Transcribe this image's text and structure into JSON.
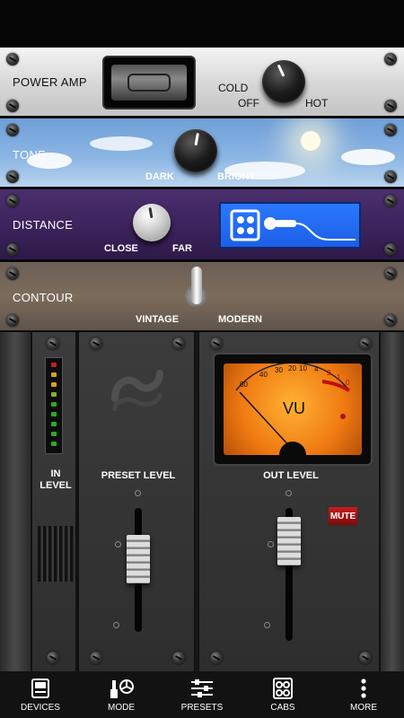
{
  "panels": {
    "power_amp": {
      "label": "POWER AMP",
      "left_label": "COLD",
      "off_label": "OFF",
      "right_label": "HOT"
    },
    "tone": {
      "label": "TONE",
      "left_label": "DARK",
      "right_label": "BRIGHT"
    },
    "distance": {
      "label": "DISTANCE",
      "left_label": "CLOSE",
      "right_label": "FAR"
    },
    "contour": {
      "label": "CONTOUR",
      "left_label": "VINTAGE",
      "right_label": "MODERN"
    }
  },
  "rack": {
    "in_level_label": "IN\nLEVEL",
    "preset_level_label": "PRESET LEVEL",
    "out_level_label": "OUT LEVEL",
    "mute_label": "MUTE",
    "vu_label": "VU",
    "vu_scale": [
      "60",
      "40",
      "30",
      "20",
      "10",
      "4",
      "2",
      "1",
      "0"
    ]
  },
  "nav": {
    "items": [
      {
        "label": "DEVICES",
        "icon": "devices-icon"
      },
      {
        "label": "MODE",
        "icon": "mode-icon"
      },
      {
        "label": "PRESETS",
        "icon": "presets-icon"
      },
      {
        "label": "CABS",
        "icon": "cabs-icon"
      },
      {
        "label": "MORE",
        "icon": "more-icon"
      }
    ]
  },
  "colors": {
    "tone_sky": "#8ab5e4",
    "distance_purple": "#3a2259",
    "mic_display_blue": "#2a78ff",
    "vu_orange": "#f07a12",
    "mute_red": "#c81a1a"
  }
}
